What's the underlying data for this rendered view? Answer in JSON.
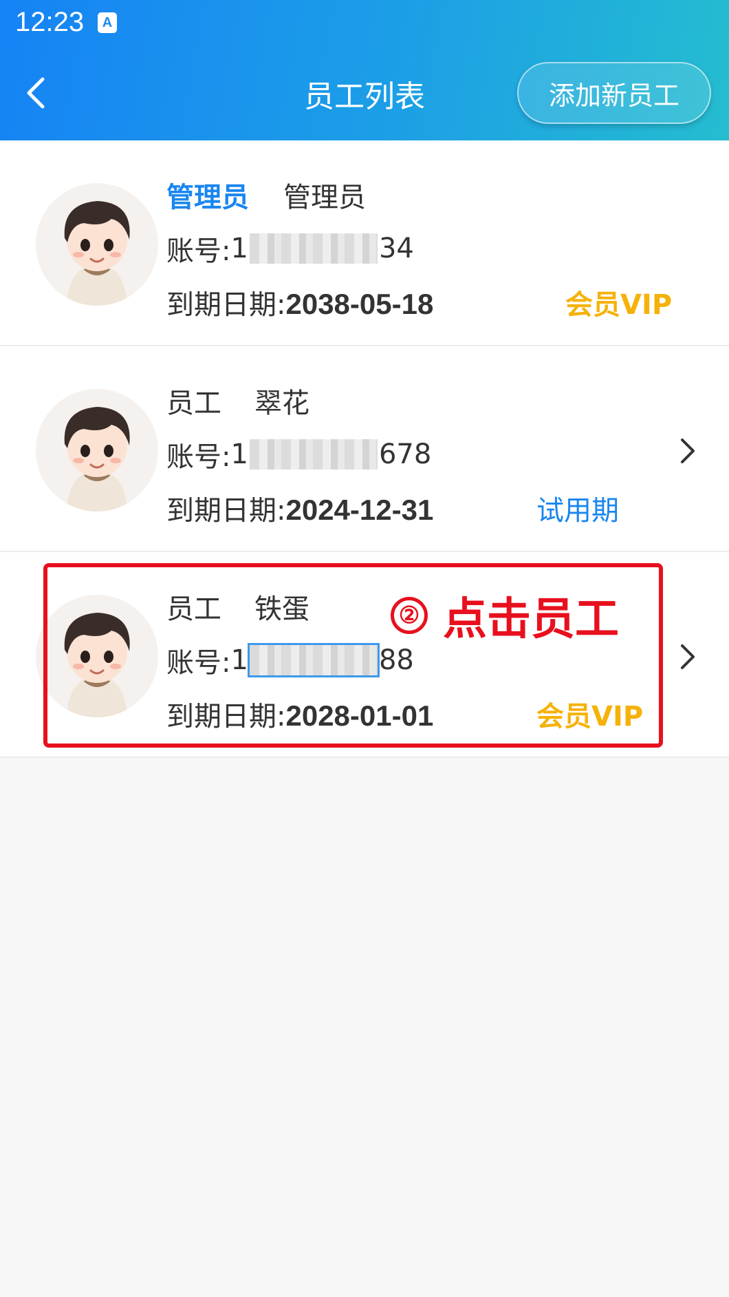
{
  "status_bar": {
    "time": "12:23",
    "app_icon": "A"
  },
  "header": {
    "back_icon": "chevron-left-icon",
    "title": "员工列表",
    "add_button": "添加新员工"
  },
  "employees": [
    {
      "role": "管理员",
      "name": "管理员",
      "account_label": "账号:",
      "account_prefix": "1",
      "account_suffix": "34",
      "expiry_label": "到期日期:",
      "expiry_date": "2038-05-18",
      "status": "会员VIP",
      "status_color": "#f5b20a",
      "has_chevron": false
    },
    {
      "role": "员工",
      "name": "翠花",
      "account_label": "账号:",
      "account_prefix": "1",
      "account_suffix": "678",
      "expiry_label": "到期日期:",
      "expiry_date": "2024-12-31",
      "status": "试用期",
      "status_color": "#1a86ef",
      "has_chevron": true
    },
    {
      "role": "员工",
      "name": "铁蛋",
      "account_label": "账号:",
      "account_prefix": "1",
      "account_suffix": "88",
      "expiry_label": "到期日期:",
      "expiry_date": "2028-01-01",
      "status": "会员VIP",
      "status_color": "#f5b20a",
      "has_chevron": true
    }
  ],
  "annotation": {
    "step": "②",
    "text": "点击员工",
    "color": "#e8101e"
  },
  "colors": {
    "accent": "#1a86ef",
    "vip": "#f5b20a",
    "header_start": "#1683f5",
    "header_end": "#25bdd0"
  }
}
